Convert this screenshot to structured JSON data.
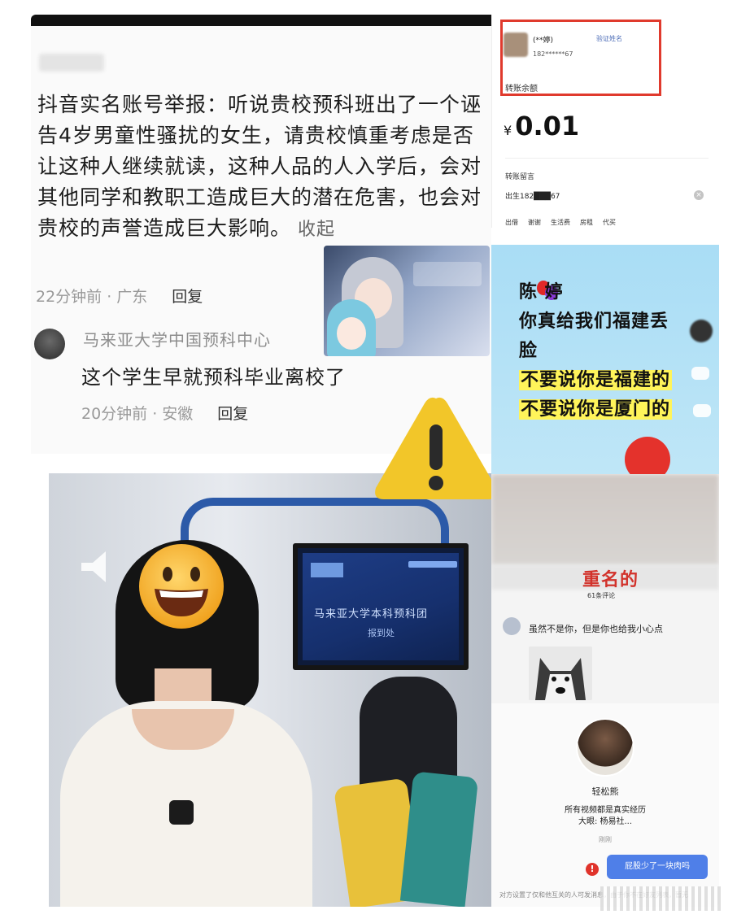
{
  "comment_panel": {
    "report_text": "抖音实名账号举报：听说贵校预科班出了一个诬告4岁男童性骚扰的女生，请贵校慎重考虑是否让这种人继续就读，这种人品的人入学后，会对其他同学和教职工造成巨大的潜在危害，也会对贵校的声誉造成巨大影响。",
    "collapse_label": "收起",
    "first_meta_time": "22分钟前 · 广东",
    "first_meta_reply": "回复",
    "reply_author": "马来亚大学中国预科中心",
    "reply_text": "这个学生早就预科毕业离校了",
    "second_meta_time": "20分钟前 · 安徽",
    "second_meta_reply": "回复"
  },
  "payment_panel": {
    "name": "(**婷)",
    "verify_link": "验证姓名",
    "phone": "182******67",
    "balance_label": "转账余额",
    "currency": "¥",
    "amount": "0.01",
    "message_label": "转账留言",
    "message": "出生182███67",
    "clear_icon": "×",
    "tags": [
      "出借",
      "谢谢",
      "生活费",
      "房租",
      "代买"
    ]
  },
  "shame_panel": {
    "line1": "陈  婷",
    "line2": "你真给我们福建丢",
    "line3": "脸",
    "line4": "不要说你是福建的",
    "line5": "不要说你是厦门的",
    "accent": "#fff45a"
  },
  "duplicate_panel": {
    "title": "重名的",
    "comment_count": "61条评论",
    "comment_text": "虽然不是你，但是你也给我小心点"
  },
  "profile_panel": {
    "name": "轻松熊",
    "bio_line1": "所有视频都是真实经历",
    "bio_line2": "大眼: 杨易社...",
    "timestamp": "刚刚",
    "error_icon": "!",
    "message": "屁股少了一块肉吗",
    "notice": "对方设置了仅和他互关的人可发消息，由于你不在好友列表，暂无"
  },
  "photo": {
    "tv_line1": "马来亚大学本科预科团",
    "tv_line2": "报到处"
  },
  "colors": {
    "highlight_red": "#e03a2d",
    "warning_yellow": "#f2c629",
    "chat_blue": "#4f7fe8"
  }
}
